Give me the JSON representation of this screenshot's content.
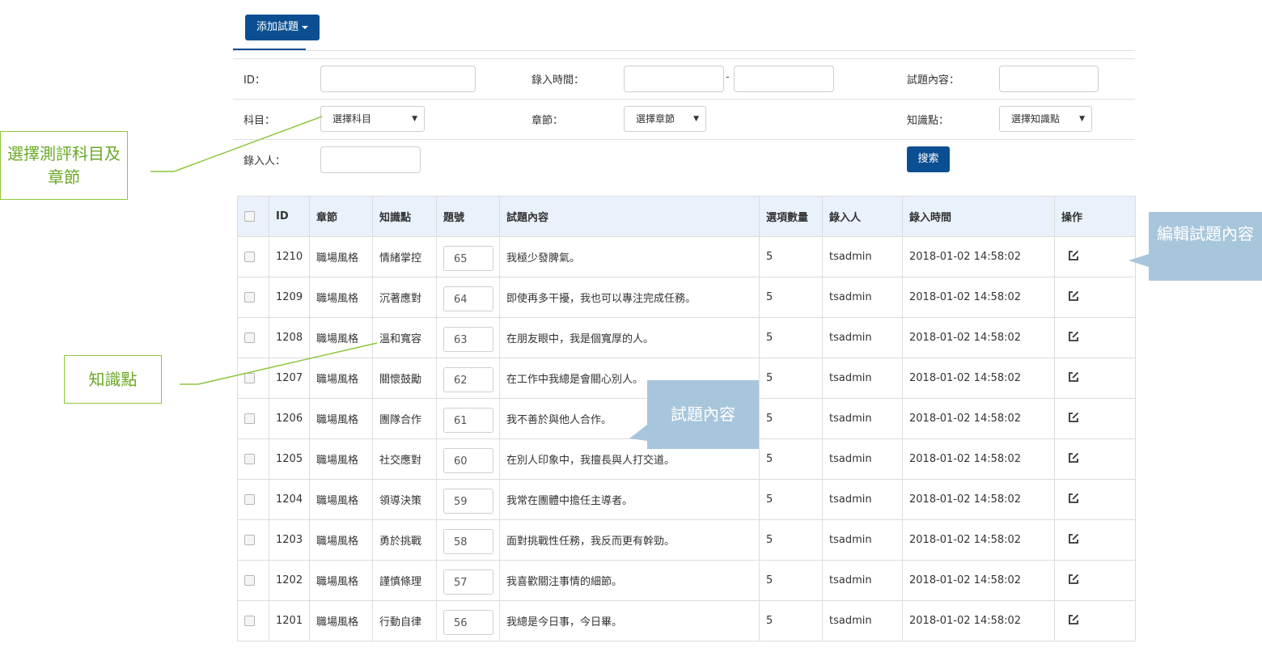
{
  "toolbar": {
    "add_label": "添加試題"
  },
  "filters": {
    "id_label": "ID：",
    "entry_time_label": "錄入時間：",
    "dash": "-",
    "content_label": "試題內容：",
    "subject_label": "科目：",
    "subject_value": "選擇科目",
    "chapter_label": "章節：",
    "chapter_value": "選擇章節",
    "knowledge_label": "知識點：",
    "knowledge_value": "選擇知識點",
    "enterer_label": "錄入人：",
    "search_label": "搜索"
  },
  "table": {
    "headers": [
      "ID",
      "章節",
      "知識點",
      "題號",
      "試題內容",
      "選項數量",
      "錄入人",
      "錄入時間",
      "操作"
    ],
    "rows": [
      {
        "id": "1210",
        "chapter": "職場風格",
        "knowledge": "情緒掌控",
        "num": "65",
        "content": "我極少發脾氣。",
        "options": "5",
        "user": "tsadmin",
        "time": "2018-01-02 14:58:02"
      },
      {
        "id": "1209",
        "chapter": "職場風格",
        "knowledge": "沉著應對",
        "num": "64",
        "content": "即使再多干擾，我也可以專注完成任務。",
        "options": "5",
        "user": "tsadmin",
        "time": "2018-01-02 14:58:02"
      },
      {
        "id": "1208",
        "chapter": "職場風格",
        "knowledge": "溫和寬容",
        "num": "63",
        "content": "在朋友眼中，我是個寬厚的人。",
        "options": "5",
        "user": "tsadmin",
        "time": "2018-01-02 14:58:02"
      },
      {
        "id": "1207",
        "chapter": "職場風格",
        "knowledge": "關懷鼓勵",
        "num": "62",
        "content": "在工作中我總是會關心別人。",
        "options": "5",
        "user": "tsadmin",
        "time": "2018-01-02 14:58:02"
      },
      {
        "id": "1206",
        "chapter": "職場風格",
        "knowledge": "團隊合作",
        "num": "61",
        "content": "我不善於與他人合作。",
        "options": "5",
        "user": "tsadmin",
        "time": "2018-01-02 14:58:02"
      },
      {
        "id": "1205",
        "chapter": "職場風格",
        "knowledge": "社交應對",
        "num": "60",
        "content": "在別人印象中，我擅長與人打交道。",
        "options": "5",
        "user": "tsadmin",
        "time": "2018-01-02 14:58:02"
      },
      {
        "id": "1204",
        "chapter": "職場風格",
        "knowledge": "領導決策",
        "num": "59",
        "content": "我常在團體中擔任主導者。",
        "options": "5",
        "user": "tsadmin",
        "time": "2018-01-02 14:58:02"
      },
      {
        "id": "1203",
        "chapter": "職場風格",
        "knowledge": "勇於挑戰",
        "num": "58",
        "content": "面對挑戰性任務，我反而更有幹勁。",
        "options": "5",
        "user": "tsadmin",
        "time": "2018-01-02 14:58:02"
      },
      {
        "id": "1202",
        "chapter": "職場風格",
        "knowledge": "謹慎條理",
        "num": "57",
        "content": "我喜歡關注事情的細節。",
        "options": "5",
        "user": "tsadmin",
        "time": "2018-01-02 14:58:02"
      },
      {
        "id": "1201",
        "chapter": "職場風格",
        "knowledge": "行動自律",
        "num": "56",
        "content": "我總是今日事，今日畢。",
        "options": "5",
        "user": "tsadmin",
        "time": "2018-01-02 14:58:02"
      }
    ]
  },
  "annotations": {
    "select_subject": "選擇測評科目及章節",
    "knowledge": "知識點",
    "question_content": "試題內容",
    "edit_content": "編輯試題內容"
  },
  "colors": {
    "primary": "#0b4f92",
    "header_bg": "#e9f1fb",
    "callout_green": "#8dc63f",
    "callout_blue": "#a8c6db"
  }
}
